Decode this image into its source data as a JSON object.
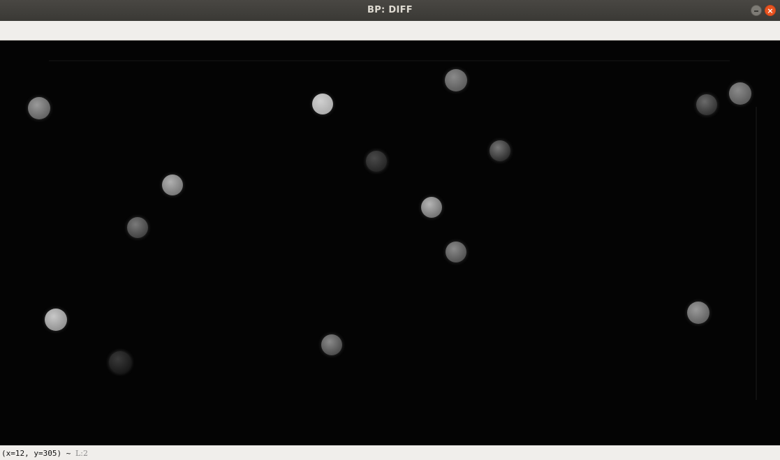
{
  "window": {
    "title": "BP: DIFF",
    "minimize_icon": "minimize-icon",
    "close_icon": "close-icon",
    "close_color": "#e95420"
  },
  "canvas": {
    "background": "#040404",
    "image_type": "difference image of billiard balls on a table"
  },
  "status": {
    "coords": "(x=12, y=305) ~",
    "level": "L:2"
  }
}
